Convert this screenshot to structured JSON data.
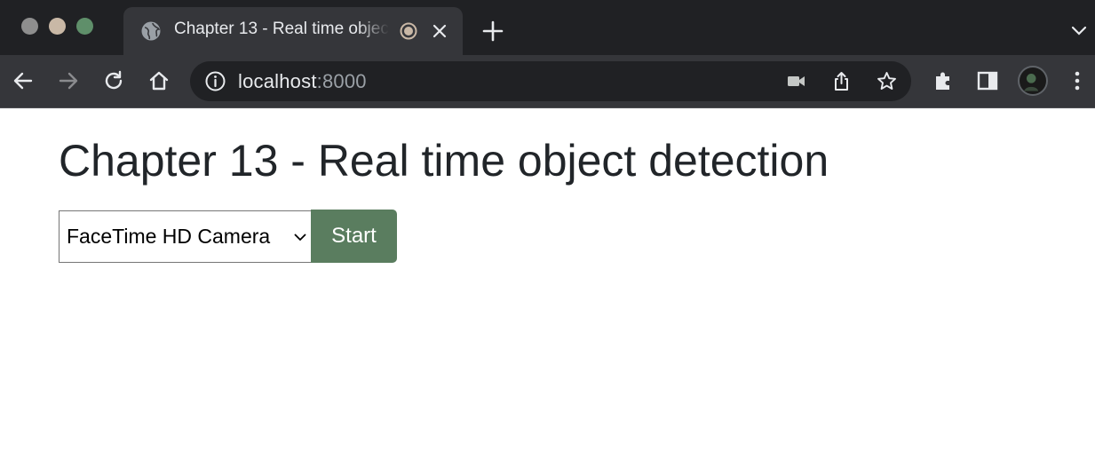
{
  "browser": {
    "tab": {
      "title": "Chapter 13 - Real time object detection",
      "icon": "globe-icon",
      "recording_icon": "recording-indicator-icon"
    },
    "address_bar": {
      "host": "localhost",
      "port": ":8000"
    },
    "toolbar_icons": [
      "back-icon",
      "forward-icon",
      "reload-icon",
      "home-icon",
      "site-info-icon",
      "camera-icon",
      "share-icon",
      "bookmark-star-icon",
      "extensions-icon",
      "side-panel-icon",
      "profile-avatar",
      "menu-dots-icon"
    ],
    "traffic_light_colors": [
      "#8e8e8e",
      "#c9b8a6",
      "#5f8f6a"
    ]
  },
  "page": {
    "heading": "Chapter 13 - Real time object detection",
    "camera_select": {
      "selected": "FaceTime HD Camera"
    },
    "start_button": "Start"
  },
  "colors": {
    "start_button_bg": "#5a7d5f",
    "heading_text": "#212529"
  }
}
